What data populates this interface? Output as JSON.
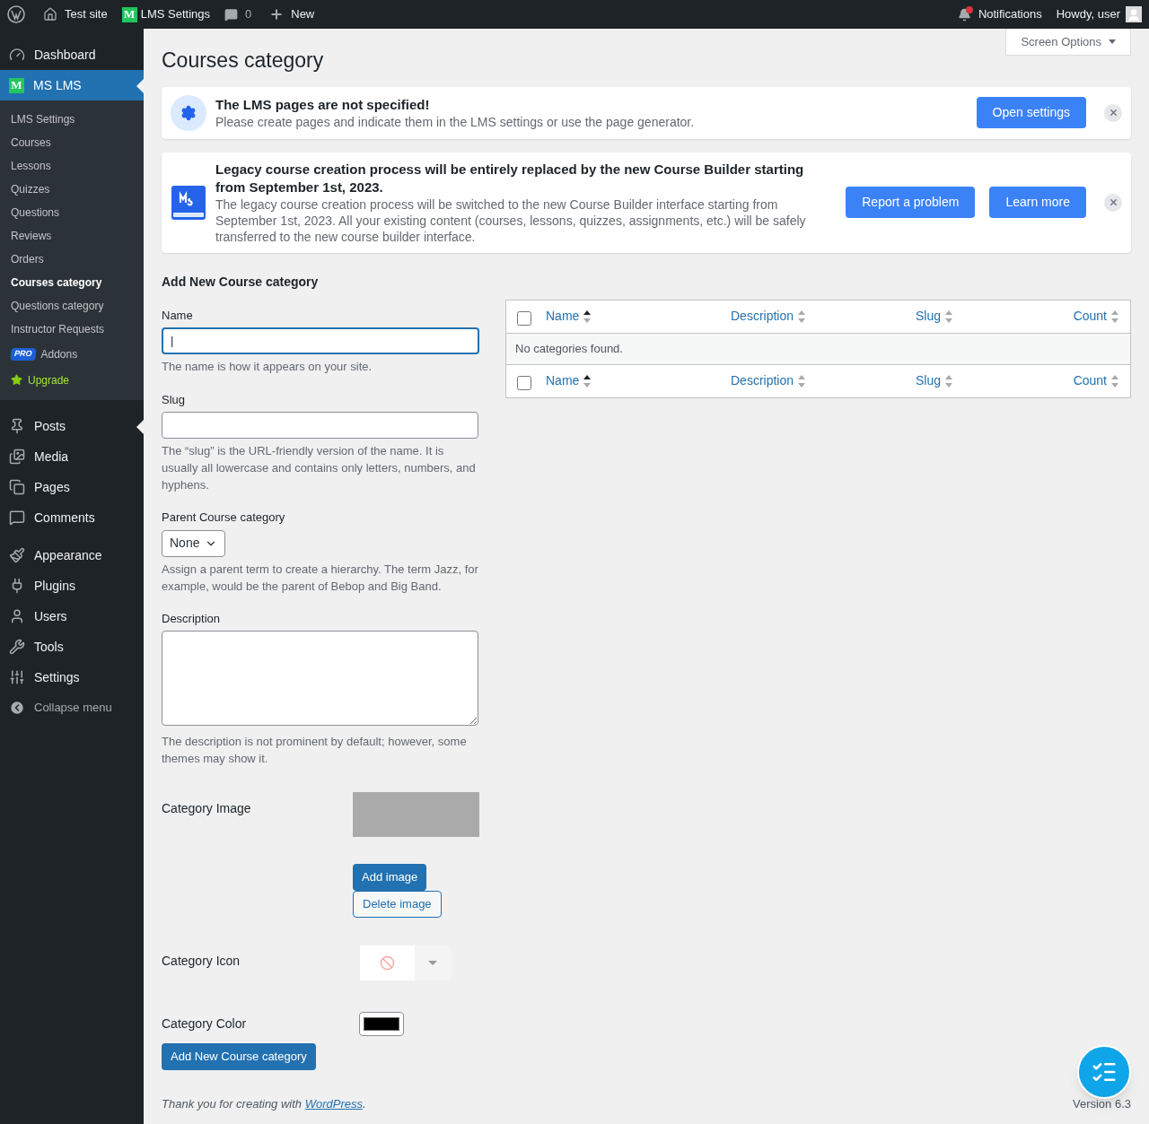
{
  "admin_bar": {
    "site": "Test site",
    "plugin": "LMS Settings",
    "plugin_logo": "M",
    "comments": "0",
    "new": "New",
    "notifications": "Notifications",
    "greeting": "Howdy, user",
    "notification_dot": true
  },
  "sidebar": {
    "items": [
      {
        "label": "Dashboard",
        "selected": false
      },
      {
        "label": "MS LMS",
        "selected": true,
        "logo": "M",
        "children": [
          {
            "label": "LMS Settings",
            "selected": false,
            "kind": "link"
          },
          {
            "label": "Courses",
            "selected": false,
            "kind": "link"
          },
          {
            "label": "Lessons",
            "selected": false,
            "kind": "link"
          },
          {
            "label": "Quizzes",
            "selected": false,
            "kind": "link"
          },
          {
            "label": "Questions",
            "selected": false,
            "kind": "link"
          },
          {
            "label": "Reviews",
            "selected": false,
            "kind": "link"
          },
          {
            "label": "Orders",
            "selected": false,
            "kind": "link"
          },
          {
            "label": "Courses category",
            "selected": true,
            "kind": "link"
          },
          {
            "label": "Questions category",
            "selected": false,
            "kind": "link"
          },
          {
            "label": "Instructor Requests",
            "selected": false,
            "kind": "link"
          },
          {
            "label": "Addons",
            "selected": false,
            "kind": "pro",
            "badge": "PRO"
          },
          {
            "label": "Upgrade",
            "selected": false,
            "kind": "upgrade"
          }
        ]
      },
      {
        "label": "Posts",
        "selected": false
      },
      {
        "label": "Media",
        "selected": false
      },
      {
        "label": "Pages",
        "selected": false
      },
      {
        "label": "Comments",
        "selected": false
      },
      {
        "label": "Appearance",
        "selected": false
      },
      {
        "label": "Plugins",
        "selected": false
      },
      {
        "label": "Users",
        "selected": false
      },
      {
        "label": "Tools",
        "selected": false
      },
      {
        "label": "Settings",
        "selected": false
      }
    ],
    "collapse": "Collapse menu"
  },
  "screen_options": "Screen Options",
  "page_title": "Courses category",
  "notices": [
    {
      "title": "The LMS pages are not specified!",
      "text": "Please create pages and indicate them in the LMS settings or use the page generator.",
      "buttons": [
        "Open settings"
      ],
      "kind": "settings"
    },
    {
      "title": "Legacy course creation process will be entirely replaced by the new Course Builder starting from September 1st, 2023.",
      "text": "The legacy course creation process will be switched to the new Course Builder interface starting from September 1st, 2023. All your existing content (courses, lessons, quizzes, assignments, etc.) will be safely transferred to the new course builder interface.",
      "buttons": [
        "Report a problem",
        "Learn more"
      ],
      "kind": "logo"
    }
  ],
  "form": {
    "heading": "Add New Course category",
    "name": {
      "label": "Name",
      "hint": "The name is how it appears on your site.",
      "value": "|"
    },
    "slug": {
      "label": "Slug",
      "hint": "The “slug” is the URL-friendly version of the name. It is usually all lowercase and contains only letters, numbers, and hyphens."
    },
    "parent": {
      "label": "Parent Course category",
      "value": "None",
      "hint": "Assign a parent term to create a hierarchy. The term Jazz, for example, would be the parent of Bebop and Big Band."
    },
    "description": {
      "label": "Description",
      "hint": "The description is not prominent by default; however, some themes may show it."
    },
    "image": {
      "label": "Category Image",
      "add": "Add image",
      "delete": "Delete image"
    },
    "icon": {
      "label": "Category Icon"
    },
    "color": {
      "label": "Category Color",
      "color": "#000000"
    },
    "submit": "Add New Course category"
  },
  "table": {
    "header_checked": false,
    "footer_checked": false,
    "columns": [
      {
        "label": "Name",
        "sorted": true
      },
      {
        "label": "Description",
        "sorted": false
      },
      {
        "label": "Slug",
        "sorted": false
      },
      {
        "label": "Count",
        "sorted": false
      }
    ],
    "empty": "No categories found.",
    "footer_columns": [
      {
        "label": "Name",
        "sorted": true
      },
      {
        "label": "Description",
        "sorted": false
      },
      {
        "label": "Slug",
        "sorted": false
      },
      {
        "label": "Count",
        "sorted": false
      }
    ]
  },
  "footer": {
    "text": "Thank you for creating with ",
    "link": "WordPress",
    "after": ".",
    "version": "Version 6.3"
  }
}
